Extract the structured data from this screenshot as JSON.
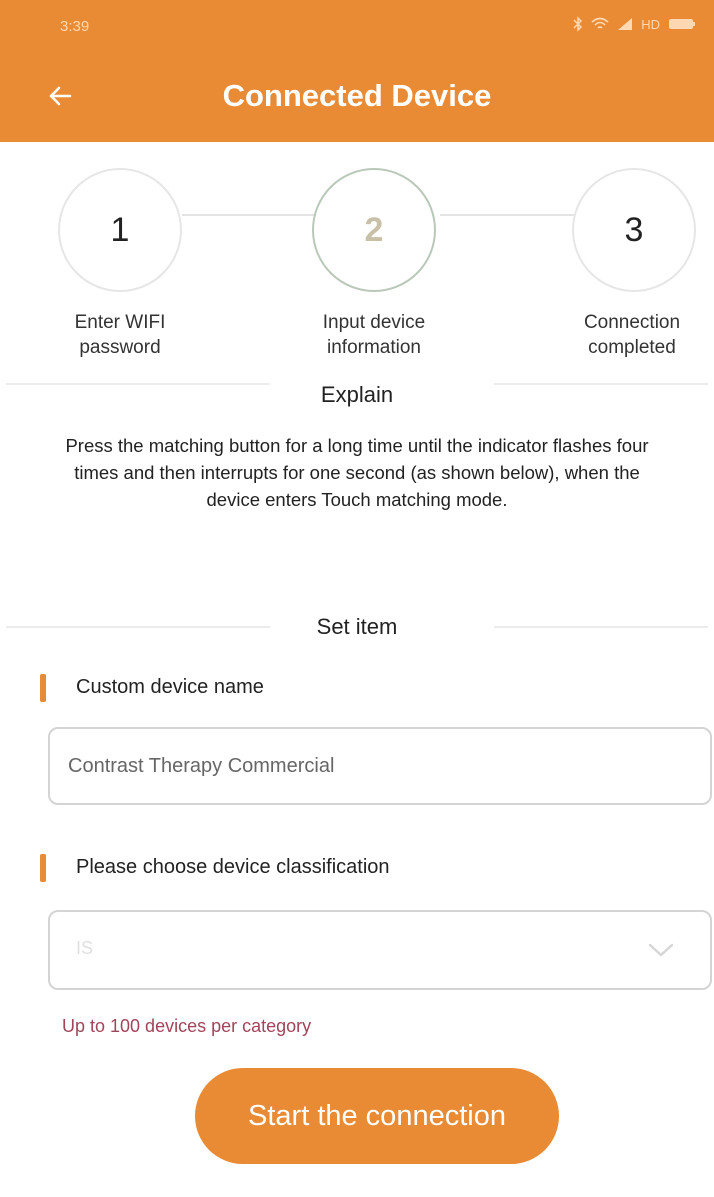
{
  "status_bar": {
    "time": "3:39",
    "network": "HD"
  },
  "header": {
    "title": "Connected Device",
    "back_icon": "arrow-left-icon"
  },
  "steps": [
    {
      "number": "1",
      "label_line1": "Enter WIFI",
      "label_line2": "password",
      "active": false
    },
    {
      "number": "2",
      "label_line1": "Input device",
      "label_line2": "information",
      "active": true
    },
    {
      "number": "3",
      "label_line1": "Connection",
      "label_line2": "completed",
      "active": false
    }
  ],
  "explain": {
    "title": "Explain",
    "line1": "Press the matching button for a long time until the indicator flashes four",
    "line2": "times and then interrupts for one second (as shown below), when the",
    "line3": "device enters Touch matching mode."
  },
  "set_item": {
    "title": "Set item"
  },
  "device_name": {
    "label": "Custom device name",
    "value": "Contrast Therapy Commercial"
  },
  "classification": {
    "label": "Please choose device classification",
    "selected": "IS"
  },
  "hint": "Up to 100 devices per category",
  "start_button": "Start the connection",
  "colors": {
    "accent": "#e98a34",
    "hint": "#a0455a"
  }
}
